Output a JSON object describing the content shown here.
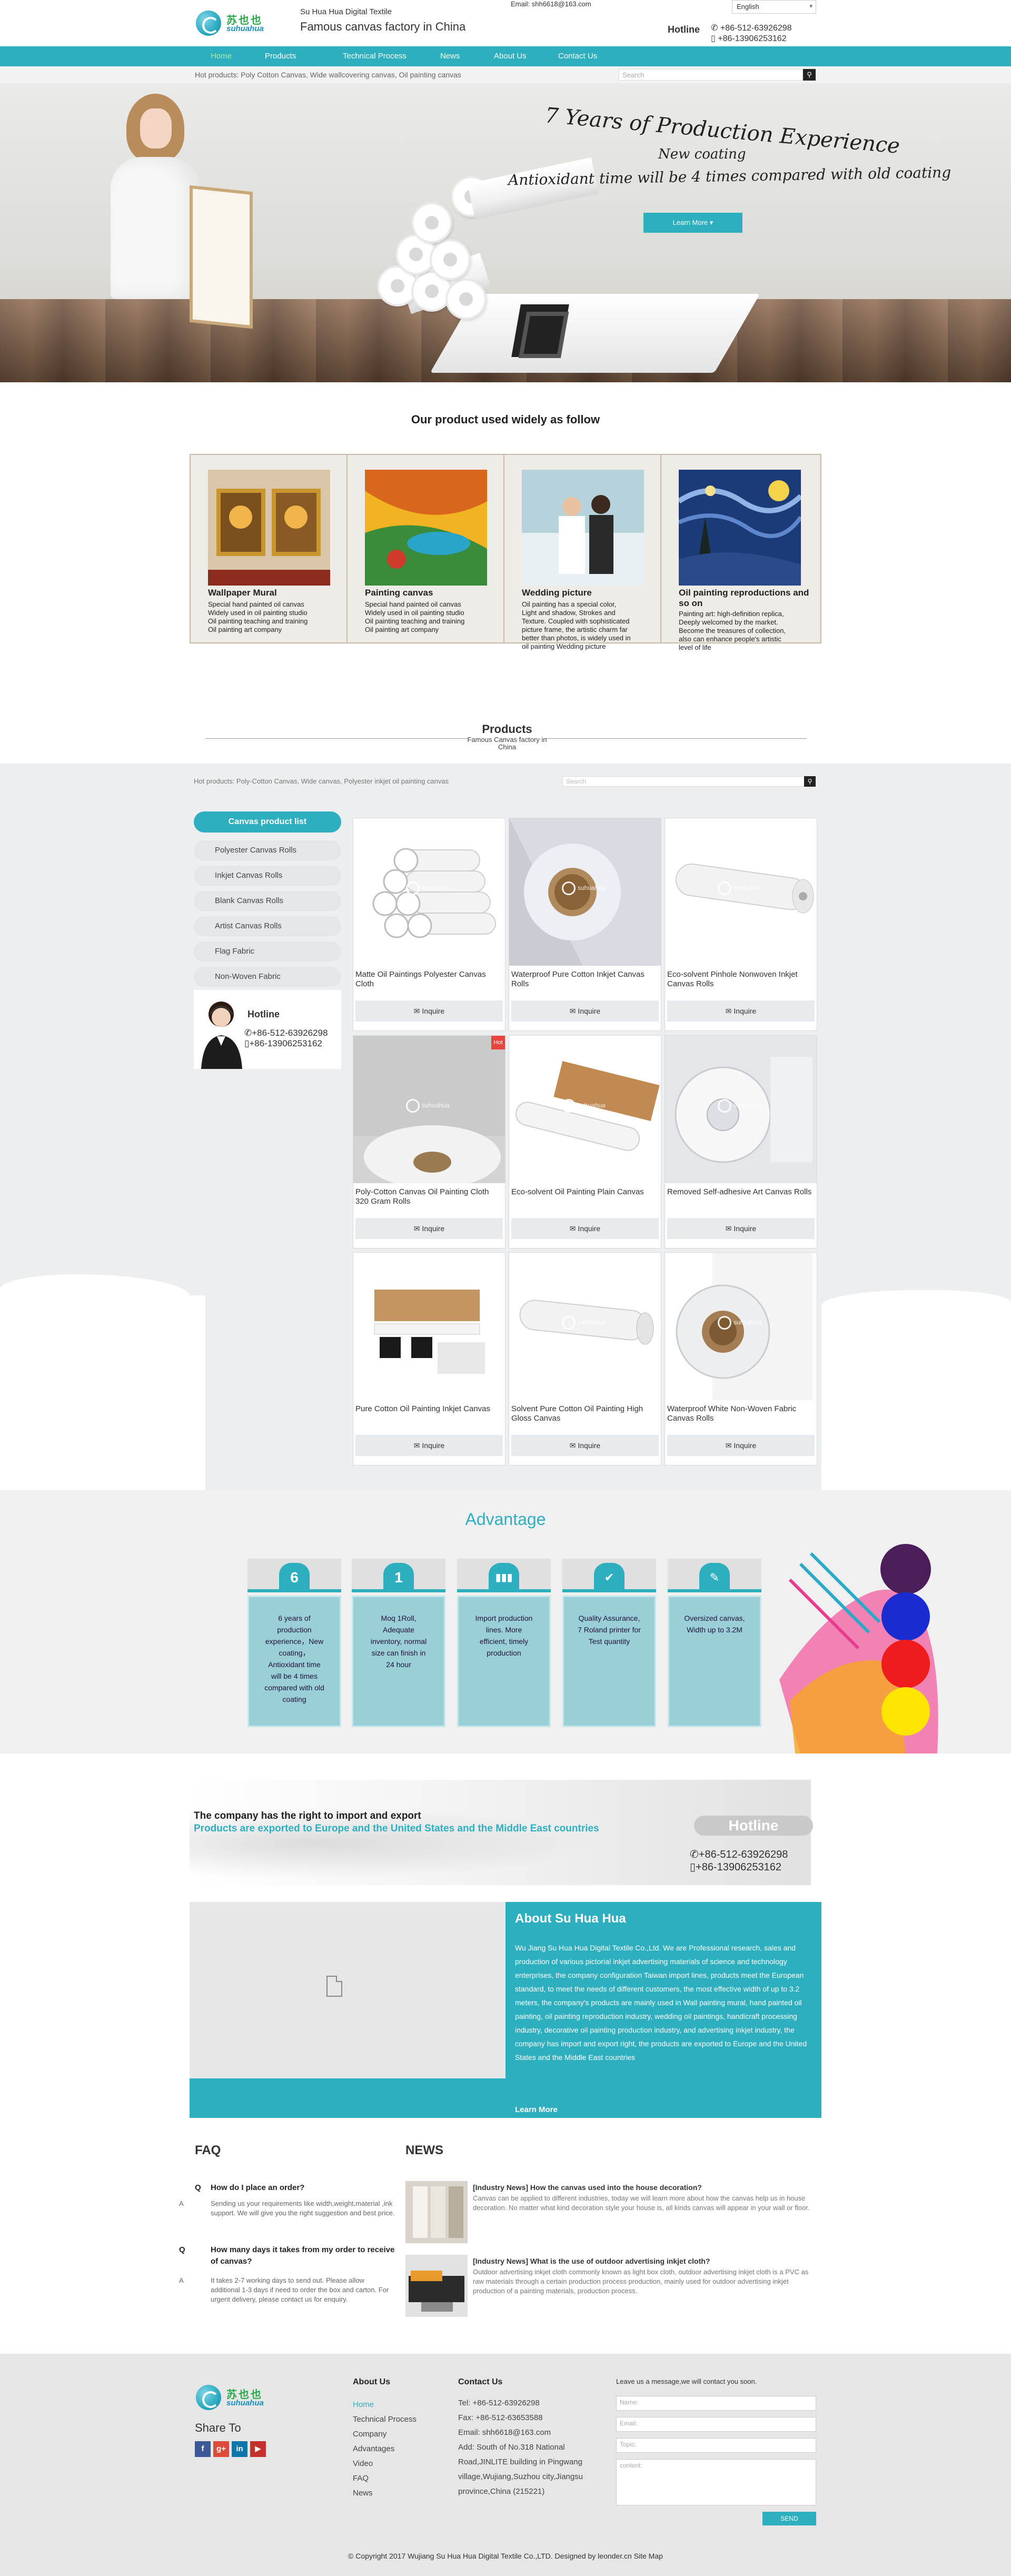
{
  "brand": {
    "logo_cn": "苏也也",
    "logo_en": "suhuahua",
    "company_small": "Su Hua Hua Digital Textile",
    "tagline": "Famous canvas factory in China",
    "accent": "#2eafc0"
  },
  "header": {
    "email": "Email: shh6618@163.com",
    "language": "English",
    "hotline_label": "Hotline",
    "phone1": "+86-512-63926298",
    "phone2": "+86-13906253162"
  },
  "nav": [
    "Home",
    "Products",
    "Technical Process",
    "News",
    "About Us",
    "Contact Us"
  ],
  "hotbar": {
    "text": "Hot products: Poly Cotton Canvas, Wide wallcovering canvas, Oil painting canvas",
    "search_placeholder": "Search"
  },
  "banner": {
    "line1": "7 Years of Production Experience",
    "line2": "New coating",
    "line3": "Antioxidant time will be 4 times compared with old coating",
    "button": "Learn More"
  },
  "usage": {
    "title": "Our product used widely as follow",
    "items": [
      {
        "title": "Wallpaper Mural",
        "desc": "Special hand painted oil canvas\nWidely used in oil painting studio\nOil painting teaching and training\nOil painting art company"
      },
      {
        "title": "Painting canvas",
        "desc": "Special hand painted oil canvas\nWidely used in oil painting studio\nOil painting teaching and training\nOil painting art company"
      },
      {
        "title": "Wedding picture",
        "desc": "Oil painting has a special color,\nLight and shadow, Strokes and\nTexture. Coupled with sophisticated\npicture frame, the artistic charm far\nbetter than photos, is widely used in\noil painting Wedding picture"
      },
      {
        "title": "Oil painting reproductions and so on",
        "desc": "Painting art: high-definition replica,\nDeeply welcomed by the market.\nBecome the treasures of collection,\nalso can enhance people's artistic\nlevel of life"
      }
    ]
  },
  "products": {
    "title": "Products",
    "subtitle": "Famous Canvas factory in China",
    "hot_text": "Hot products: Poly-Cotton Canvas, Wide canvas, Polyester inkjet oil painting canvas",
    "search_placeholder": "Search",
    "sidebar_title": "Canvas product list",
    "sidebar": [
      "Polyester Canvas Rolls",
      "Inkjet Canvas Rolls",
      "Blank Canvas Rolls",
      "Artist Canvas Rolls",
      "Flag Fabric",
      "Non-Woven Fabric"
    ],
    "hotline_label": "Hotline",
    "hotline1": "+86-512-63926298",
    "hotline2": "+86-13906253162",
    "inquire": "Inquire",
    "hot_badge": "Hot",
    "watermark": "suhuahua",
    "items": [
      "Matte Oil Paintings Polyester Canvas Cloth",
      "Waterproof Pure Cotton Inkjet Canvas Rolls",
      "Eco-solvent Pinhole Nonwoven Inkjet Canvas Rolls",
      "Poly-Cotton Canvas Oil Painting Cloth 320 Gram Rolls",
      "Eco-solvent Oil Painting Plain Canvas",
      "Removed Self-adhesive Art Canvas Rolls",
      "Pure Cotton Oil Painting Inkjet Canvas",
      "Solvent Pure Cotton Oil Painting High Gloss Canvas",
      "Waterproof White Non-Woven Fabric Canvas Rolls"
    ]
  },
  "advantage": {
    "title": "Advantage",
    "items": [
      {
        "num": "6",
        "text": "6 years of production experience，New coating，Antioxidant time will be 4 times compared with old coating"
      },
      {
        "num": "1",
        "text": "Moq 1Roll, Adequate inventory, normal size can finish in 24 hour"
      },
      {
        "num": "",
        "text": "Import production lines. More efficient, timely production"
      },
      {
        "num": "",
        "text": "Quality Assurance, 7 Roland printer for Test quantity"
      },
      {
        "num": "",
        "text": "Oversized canvas, Width up to 3.2M"
      }
    ]
  },
  "company": {
    "line1": "The company has the right to import and export",
    "line2": "Products are exported to Europe and the United States and the Middle East countries",
    "hotline": "Hotline",
    "phone1": "+86-512-63926298",
    "phone2": "+86-13906253162"
  },
  "about": {
    "title": "About Su Hua Hua",
    "text": "Wu Jiang Su Hua Hua Digital Textile Co.,Ltd. We are Professional research, sales and production of various pictorial inkjet advertising materials of science and technology enterprises, the company configuration Taiwan import lines, products meet the European standard, to meet the needs of different customers, the most effective width of up to 3.2 meters, the company's products are mainly used in Wall painting mural, hand painted oil painting, oil painting reproduction industry, wedding oil paintings, handicraft processing industry, decorative oil painting production industry, and advertising inkjet industry, the company has import and export right, the products are exported to Europe and the United States and the Middle East countries",
    "more": "Learn More"
  },
  "faq": {
    "title": "FAQ",
    "items": [
      {
        "q": "How do I place an order?",
        "a": "Sending us your requirements like width,weight,material ,ink support. We will give you the right suggestion and best price."
      },
      {
        "q": "How many days it takes from my order to receive of canvas?",
        "a": "It takes 2-7 working days to send out. Please allow additional 1-3 days if need to order the box and carton. For urgent delivery, please contact us for enquiry."
      }
    ]
  },
  "news": {
    "title": "NEWS",
    "items": [
      {
        "title": "[Industry News] How the canvas used into the house decoration?",
        "text": "Canvas can be applied to different industries, today we will learn more about how the canvas help us in house decoration. No matter what kind decoration style your house is, all kinds canvas will appear in your wall or floor."
      },
      {
        "title": "[Industry News] What is the use of outdoor advertising inkjet cloth?",
        "text": "Outdoor advertising inkjet cloth commonly known as light box cloth, outdoor advertising inkjet cloth is a PVC as raw materials through a certain production process production, mainly used for outdoor advertising inkjet production of a painting materials, production process."
      }
    ]
  },
  "footer": {
    "share": "Share To",
    "about_head": "About Us",
    "links": [
      "Home",
      "Technical Process",
      "Company",
      "Advantages",
      "Video",
      "FAQ",
      "News"
    ],
    "contact_head": "Contact Us",
    "tel": "Tel: +86-512-63926298",
    "fax": "Fax: +86-512-63653588",
    "email": "Email: shh6618@163.com",
    "addr": "Add: South of No.318 National Road,JINLITE building in Pingwang village,Wujiang,Suzhou city,Jiangsu province,China (215221)",
    "msg_head": "Leave us a message,we will contact you soon.",
    "name_ph": "Name:",
    "email_ph": "Email:",
    "topic_ph": "Topic:",
    "content_ph": "content:",
    "send": "SEND",
    "copyright": "© Copyright 2017 Wujiang Su Hua Hua Digital Textile Co.,LTD.   Designed by leonder.cn   Site Map"
  }
}
